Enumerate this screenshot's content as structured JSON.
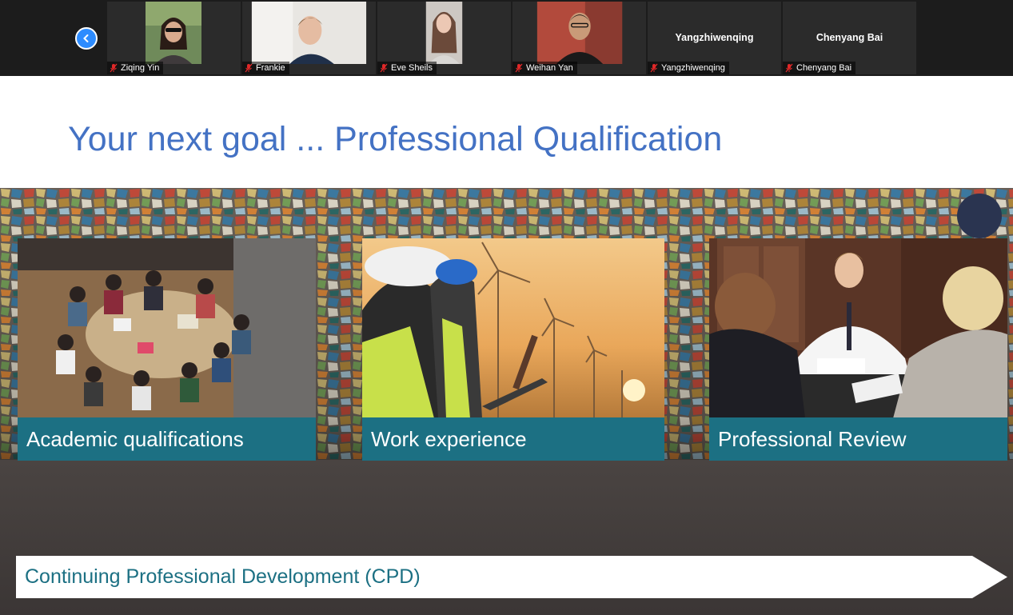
{
  "participants": [
    {
      "name": "Ziqing Yin",
      "video": true,
      "mic_muted": true
    },
    {
      "name": "Frankie",
      "video": true,
      "mic_muted": true
    },
    {
      "name": "Eve Sheils",
      "video": true,
      "mic_muted": true
    },
    {
      "name": "Weihan Yan",
      "video": true,
      "mic_muted": true
    },
    {
      "name": "Yangzhiwenqing",
      "display_name": "Yangzhiwenqing",
      "video": false,
      "mic_muted": true
    },
    {
      "name": "Chenyang Bai",
      "display_name": "Chenyang Bai",
      "video": false,
      "mic_muted": true
    }
  ],
  "nav": {
    "icon": "chevron-left-icon"
  },
  "slide": {
    "title": "Your next goal ... Professional Qualification",
    "cards": [
      {
        "caption": "Academic qualifications",
        "image": "students-studying-photo"
      },
      {
        "caption": "Work experience",
        "image": "engineers-wind-turbines-photo"
      },
      {
        "caption": "Professional Review",
        "image": "interview-meeting-photo"
      }
    ],
    "footer_arrow": "Continuing Professional Development (CPD)"
  },
  "colors": {
    "title_blue": "#4472c4",
    "caption_teal": "#1c7083",
    "zoom_blue": "#2d8cff",
    "muted_red": "#e02828"
  }
}
